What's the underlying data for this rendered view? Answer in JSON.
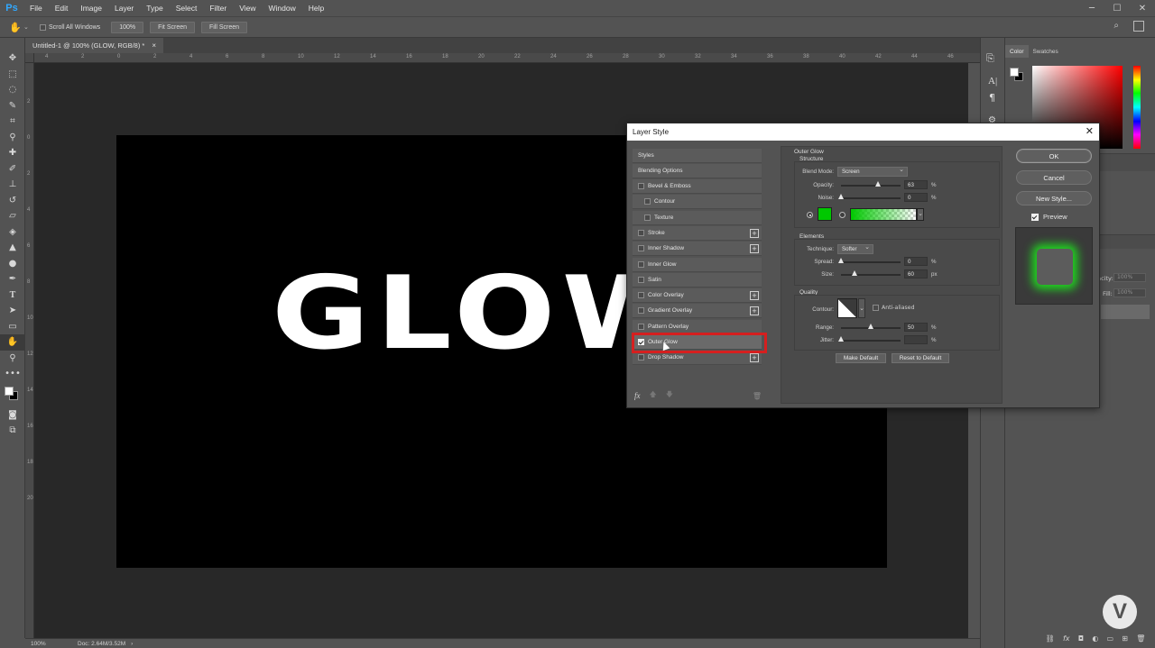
{
  "app": {
    "logo": "Ps",
    "menu": [
      "File",
      "Edit",
      "Image",
      "Layer",
      "Type",
      "Select",
      "Filter",
      "View",
      "Window",
      "Help"
    ]
  },
  "options_bar": {
    "scroll_all_windows": "Scroll All Windows",
    "zoom_100": "100%",
    "fit_screen": "Fit Screen",
    "fill_screen": "Fill Screen"
  },
  "document": {
    "tab_title": "Untitled-1 @ 100% (GLOW, RGB/8) *",
    "canvas_text": "GLOW",
    "ruler_top": [
      "4",
      "2",
      "0",
      "2",
      "4",
      "6",
      "8",
      "10",
      "12",
      "14",
      "16",
      "18",
      "20",
      "22",
      "24",
      "26",
      "28",
      "30",
      "32",
      "34",
      "36",
      "38",
      "40",
      "42",
      "44",
      "46"
    ],
    "ruler_left": [
      "2",
      "0",
      "2",
      "4",
      "6",
      "8",
      "10",
      "12",
      "14",
      "16",
      "18",
      "20"
    ]
  },
  "status_bar": {
    "zoom": "100%",
    "doc_info": "Doc: 2.64M/3.52M"
  },
  "right_panel": {
    "tab_color": "Color",
    "tab_swatches": "Swatches",
    "opacity_label": "pacity:",
    "fill_label": "Fill:",
    "opacity_value": "100%",
    "fill_value": "100%"
  },
  "dialog": {
    "title": "Layer Style",
    "styles_header": "Styles",
    "blending_options": "Blending Options",
    "items": [
      {
        "label": "Bevel & Emboss",
        "checked": false,
        "sub": false,
        "plus": false
      },
      {
        "label": "Contour",
        "checked": false,
        "sub": true,
        "plus": false
      },
      {
        "label": "Texture",
        "checked": false,
        "sub": true,
        "plus": false
      },
      {
        "label": "Stroke",
        "checked": false,
        "sub": false,
        "plus": true
      },
      {
        "label": "Inner Shadow",
        "checked": false,
        "sub": false,
        "plus": true
      },
      {
        "label": "Inner Glow",
        "checked": false,
        "sub": false,
        "plus": false
      },
      {
        "label": "Satin",
        "checked": false,
        "sub": false,
        "plus": false
      },
      {
        "label": "Color Overlay",
        "checked": false,
        "sub": false,
        "plus": true
      },
      {
        "label": "Gradient Overlay",
        "checked": false,
        "sub": false,
        "plus": true
      },
      {
        "label": "Pattern Overlay",
        "checked": false,
        "sub": false,
        "plus": false
      },
      {
        "label": "Outer Glow",
        "checked": true,
        "sub": false,
        "plus": false
      },
      {
        "label": "Drop Shadow",
        "checked": false,
        "sub": false,
        "plus": true
      }
    ],
    "footer_fx": "fx",
    "outer_glow": {
      "title": "Outer Glow",
      "structure": "Structure",
      "blend_mode_label": "Blend Mode:",
      "blend_mode_value": "Screen",
      "opacity_label": "Opacity:",
      "opacity_value": "63",
      "opacity_fraction": 0.63,
      "noise_label": "Noise:",
      "noise_value": "0",
      "noise_fraction": 0,
      "percent": "%",
      "glow_color": "#00c800",
      "elements": "Elements",
      "technique_label": "Technique:",
      "technique_value": "Softer",
      "spread_label": "Spread:",
      "spread_value": "0",
      "spread_fraction": 0,
      "size_label": "Size:",
      "size_value": "60",
      "size_fraction": 0.24,
      "px": "px",
      "quality": "Quality",
      "contour_label": "Contour:",
      "anti_aliased": "Anti-aliased",
      "range_label": "Range:",
      "range_value": "50",
      "range_fraction": 0.5,
      "jitter_label": "Jitter:",
      "jitter_value": "",
      "jitter_fraction": 0,
      "make_default": "Make Default",
      "reset_default": "Reset to Default"
    },
    "ok": "OK",
    "cancel": "Cancel",
    "new_style": "New Style...",
    "preview": "Preview"
  },
  "watermark": "V"
}
